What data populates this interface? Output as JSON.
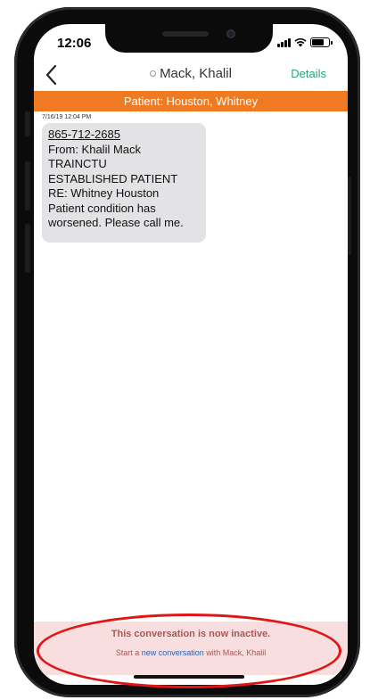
{
  "status_bar": {
    "time": "12:06"
  },
  "nav": {
    "title": "Mack, Khalil",
    "details_label": "Details"
  },
  "patient_banner": "Patient: Houston, Whitney",
  "message": {
    "timestamp": "7/16/19 12:04 PM",
    "phone": "865-712-2685",
    "lines": [
      "From: Khalil Mack",
      "TRAINCTU",
      "ESTABLISHED PATIENT",
      "RE: Whitney Houston",
      "Patient condition has",
      "worsened. Please call me."
    ]
  },
  "footer": {
    "inactive_text": "This conversation is now inactive.",
    "start_prefix": "Start a",
    "new_link": "new conversation",
    "start_suffix": "with Mack, Khalil"
  },
  "colors": {
    "banner": "#ef7a22",
    "details": "#2aa57a",
    "link": "#2b5fb8",
    "annotation": "#e01515"
  },
  "icons": [
    "back-chevron-icon",
    "signal-icon",
    "wifi-icon",
    "battery-icon",
    "status-dot-icon"
  ]
}
